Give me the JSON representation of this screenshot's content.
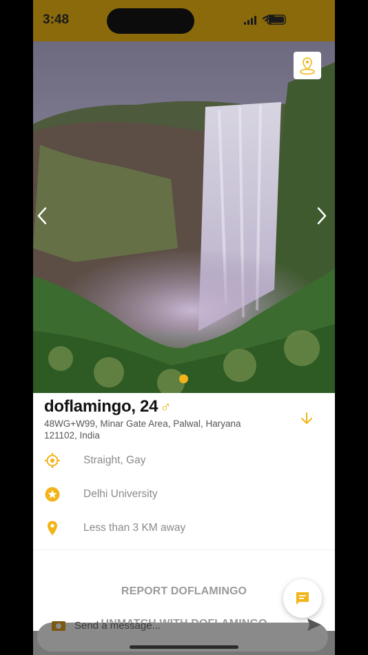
{
  "status_bar": {
    "time": "3:48"
  },
  "profile": {
    "name_age": "doflamingo, 24",
    "gender_symbol": "♂",
    "address": "48WG+W99, Minar Gate Area, Palwal, Haryana 121102, India",
    "orientation": "Straight, Gay",
    "education": "Delhi University",
    "distance": "Less than 3 KM away"
  },
  "photo": {
    "current_page": 1,
    "total_pages": 1
  },
  "actions": {
    "report": "REPORT DOFLAMINGO",
    "unmatch": "UNMATCH WITH DOFLAMINGO"
  },
  "composer": {
    "placeholder": "Send a message..."
  },
  "colors": {
    "accent": "#f2b418",
    "status_bar": "#8a6a0a"
  }
}
